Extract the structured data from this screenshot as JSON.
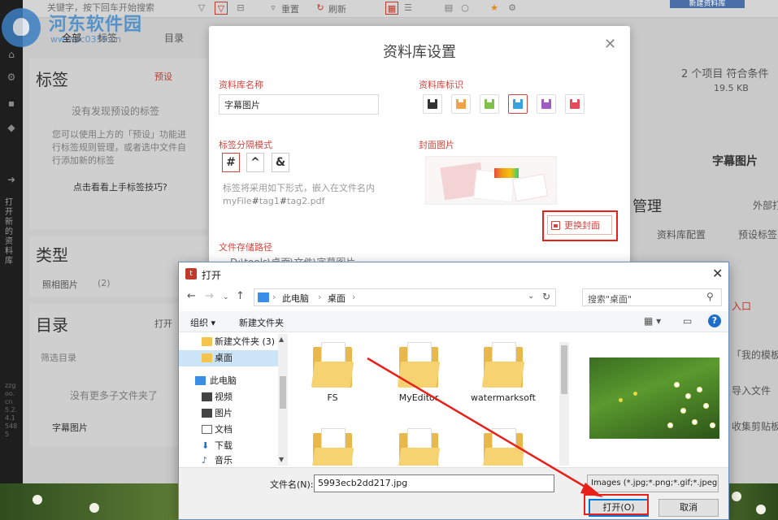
{
  "app": {
    "search_placeholder": "关键字，按下回车开始搜索",
    "toolbar_reset": "重置",
    "toolbar_refresh": "刷新",
    "new_button": "新建资料库",
    "logo_title": "河东软件园",
    "logo_url": "www.pc0359.cn",
    "tabs": [
      "全部",
      "标签",
      "目录"
    ],
    "left_rail_text": "打开新的资料库",
    "left_rail_version": "zzgoo.cn 5.2.4.15485",
    "tags_panel": {
      "title": "标签",
      "preset": "预设",
      "empty": "没有发现预设的标签",
      "hint": "您可以使用上方的「预设」功能进行标签规则管理，或者选中文件自行添加新的标签",
      "link": "点击看看上手标签技巧?"
    },
    "types_panel": {
      "title": "类型",
      "item_label": "照相图片",
      "item_count": "(2)"
    },
    "dir_panel": {
      "title": "目录",
      "open": "打开",
      "filter": "筛选目录",
      "empty": "没有更多子文件夹了",
      "item": "字幕图片"
    },
    "right": {
      "count": "2 个项目 符合条件",
      "size": "19.5 KB",
      "lib_name": "字幕图片",
      "manage_title": "管理",
      "external": "外部打",
      "config": "资料库配置",
      "preset_tags": "预设标签",
      "entrance": "入口",
      "template": "「我的模板」",
      "import": "导入文件",
      "clipboard": "收集剪贴板"
    }
  },
  "dialog": {
    "title": "资料库设置",
    "name_label": "资料库名称",
    "name_value": "字幕图片",
    "icon_label": "资料库标识",
    "icons": [
      {
        "name": "disk-dark",
        "color": "#333333"
      },
      {
        "name": "disk-orange",
        "color": "#f0a24a"
      },
      {
        "name": "disk-green",
        "color": "#7fc04a"
      },
      {
        "name": "disk-blue",
        "color": "#3aa1e0",
        "selected": true
      },
      {
        "name": "disk-purple",
        "color": "#a259c4"
      },
      {
        "name": "flag-red",
        "color": "#e24b5c"
      }
    ],
    "sep_label": "标签分隔模式",
    "separators": [
      "#",
      "^",
      "&"
    ],
    "hint_line1": "标签将采用如下形式，嵌入在文件名内",
    "hint_line2_prefix": "myFile",
    "hint_line2_sep1": "#",
    "hint_line2_mid": "tag1",
    "hint_line2_sep2": "#",
    "hint_line2_suffix": "tag2.pdf",
    "cover_label": "封面图片",
    "change_cover": "更换封面",
    "path_label": "文件存储路径",
    "path_value": "D:\\tools\\桌面\\文件\\字幕图片"
  },
  "file_dialog": {
    "title": "打开",
    "breadcrumb": [
      "此电脑",
      "桌面"
    ],
    "search_placeholder": "搜索\"桌面\"",
    "organize": "组织 ▾",
    "new_folder": "新建文件夹",
    "nav_items": [
      {
        "label": "新建文件夹 (3)",
        "icon": "folder-icon",
        "level": 2,
        "selected": false
      },
      {
        "label": "桌面",
        "icon": "folder-icon",
        "level": 2,
        "selected": true
      },
      {
        "label": "此电脑",
        "icon": "pc-icon",
        "level": 1,
        "selected": false
      },
      {
        "label": "视频",
        "icon": "video-icon",
        "level": 2,
        "selected": false
      },
      {
        "label": "图片",
        "icon": "picture-icon",
        "level": 2,
        "selected": false
      },
      {
        "label": "文档",
        "icon": "document-icon",
        "level": 2,
        "selected": false
      },
      {
        "label": "下载",
        "icon": "download-icon",
        "level": 2,
        "selected": false
      },
      {
        "label": "音乐",
        "icon": "music-icon",
        "level": 2,
        "selected": false
      }
    ],
    "files": [
      {
        "name": "FS"
      },
      {
        "name": "MyEditor"
      },
      {
        "name": "watermarksoft"
      },
      {
        "name": ""
      },
      {
        "name": ""
      },
      {
        "name": ""
      }
    ],
    "filename_label": "文件名(N):",
    "filename_value": "5993ecb2dd217.jpg",
    "filetype": "Images (*.jpg;*.png;*.gif;*.jpeg",
    "open_button": "打开(O)",
    "cancel_button": "取消"
  },
  "colors": {
    "accent": "#d0463f",
    "highlight": "#e8201a",
    "win_blue": "#0078d7"
  }
}
